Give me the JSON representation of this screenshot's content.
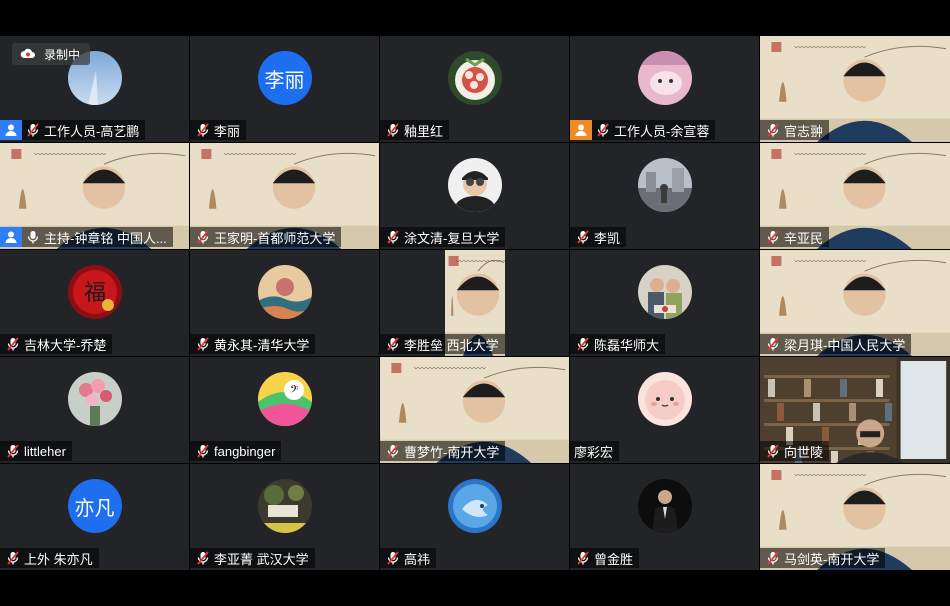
{
  "recording": {
    "label": "录制中"
  },
  "participants": [
    {
      "name": "工作人员-高艺鹏",
      "avatar": "photo-sky",
      "role": "blue",
      "mic": "muted"
    },
    {
      "name": "李丽",
      "avatar": "text",
      "avatar_text": "李丽",
      "role": "",
      "mic": "muted"
    },
    {
      "name": "釉里红",
      "avatar": "photo-carving",
      "role": "",
      "mic": "muted"
    },
    {
      "name": "工作人员-余宣蓉",
      "avatar": "photo-pink",
      "role": "orange",
      "mic": "muted"
    },
    {
      "name": "官志翀",
      "avatar": "camera",
      "role": "",
      "mic": "muted"
    },
    {
      "name": "主持-钟章铭 中国人...",
      "avatar": "camera",
      "role": "blue",
      "mic": "active"
    },
    {
      "name": "王家明-首都师范大学",
      "avatar": "camera",
      "role": "",
      "mic": "muted"
    },
    {
      "name": "涂文清-复旦大学",
      "avatar": "photo-person-goggles",
      "role": "",
      "mic": "muted"
    },
    {
      "name": "李凯",
      "avatar": "photo-street",
      "role": "",
      "mic": "muted"
    },
    {
      "name": "辛亚民",
      "avatar": "camera",
      "role": "",
      "mic": "muted"
    },
    {
      "name": "吉林大学-乔楚",
      "avatar": "photo-fu",
      "role": "",
      "mic": "muted"
    },
    {
      "name": "黄永其-清华大学",
      "avatar": "photo-landscape",
      "role": "",
      "mic": "muted"
    },
    {
      "name": "李胜垒 西北大学",
      "avatar": "camera-narrow",
      "role": "",
      "mic": "muted"
    },
    {
      "name": "陈磊华师大",
      "avatar": "photo-couple",
      "role": "",
      "mic": "muted"
    },
    {
      "name": "梁月琪-中国人民大学",
      "avatar": "camera",
      "role": "",
      "mic": "muted"
    },
    {
      "name": "littleher",
      "avatar": "photo-flowers",
      "role": "",
      "mic": "muted"
    },
    {
      "name": "fangbinger",
      "avatar": "photo-colorful",
      "role": "",
      "mic": "muted"
    },
    {
      "name": "曹梦竹-南开大学",
      "avatar": "camera",
      "role": "",
      "mic": "muted"
    },
    {
      "name": "廖彩宏",
      "avatar": "photo-cartoon",
      "role": "",
      "mic": "none"
    },
    {
      "name": "向世陵",
      "avatar": "camera-books",
      "role": "",
      "mic": "muted"
    },
    {
      "name": "上外 朱亦凡",
      "avatar": "text",
      "avatar_text": "亦凡",
      "role": "",
      "mic": "muted"
    },
    {
      "name": "李亚菁 武汉大学",
      "avatar": "photo-garden",
      "role": "",
      "mic": "muted"
    },
    {
      "name": "高祎",
      "avatar": "photo-fish",
      "role": "",
      "mic": "muted"
    },
    {
      "name": "曾金胜",
      "avatar": "photo-suit",
      "role": "",
      "mic": "muted"
    },
    {
      "name": "马剑英-南开大学",
      "avatar": "camera",
      "role": "",
      "mic": "muted"
    }
  ],
  "colors": {
    "tile_bg": "#232427",
    "role_blue": "#2f7ef7",
    "role_orange": "#f08a24",
    "avatar_text_bg": "#1e6ef0",
    "muted_red": "#e5383b"
  }
}
